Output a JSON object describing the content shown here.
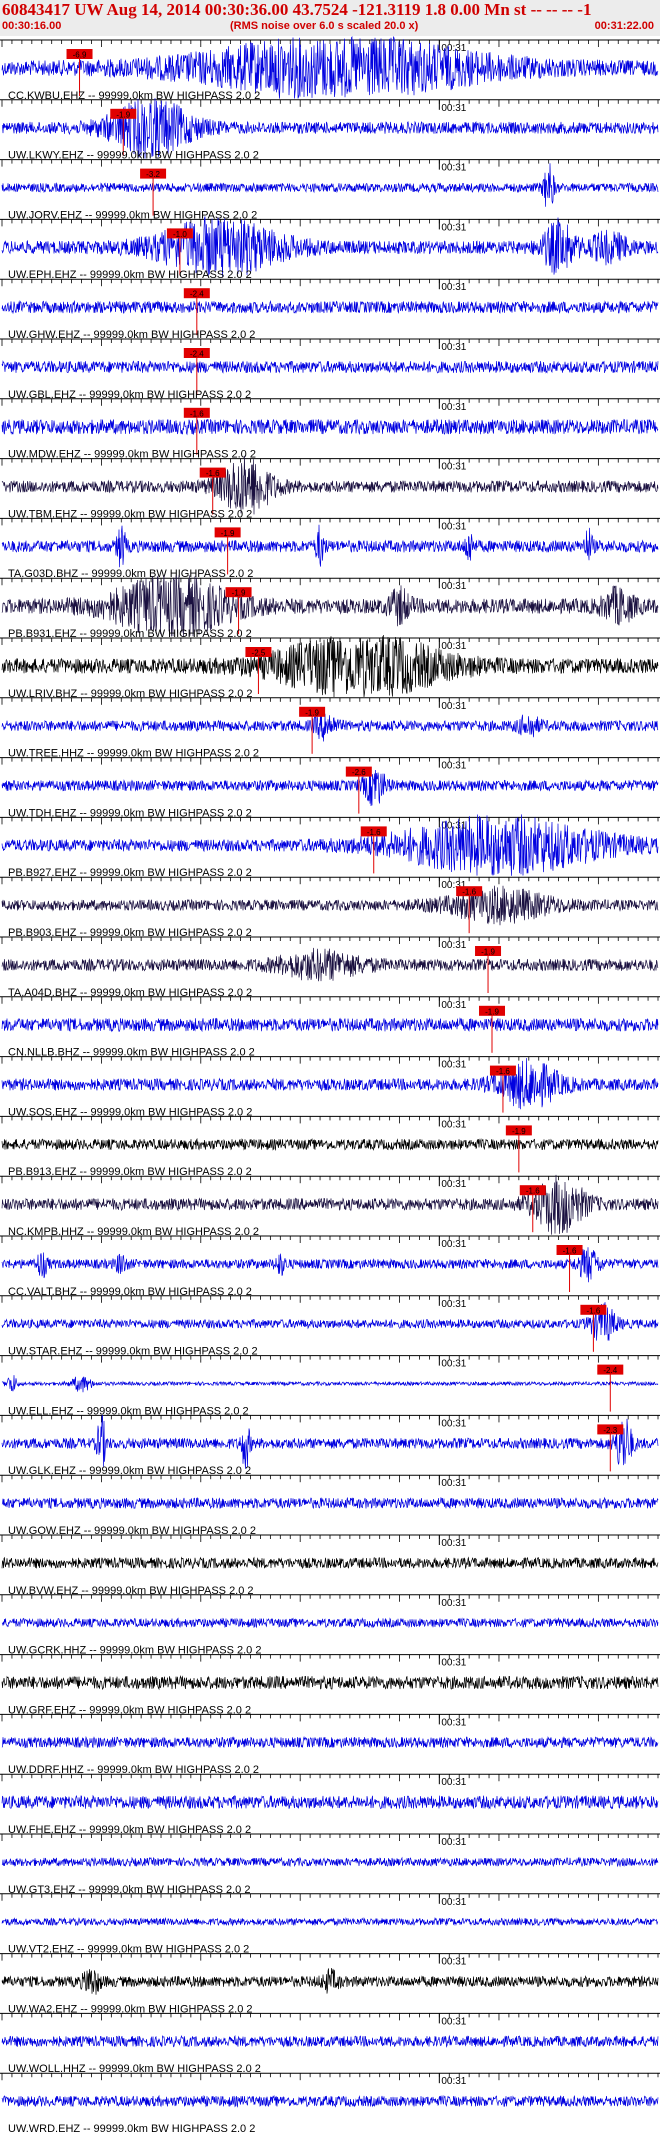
{
  "header": {
    "title": "60843417 UW Aug 14, 2014 00:30:36.00   43.7524 -121.3119  1.8 0.00 Mn st -- -- --  -1",
    "start_time": "00:30:16.00",
    "subtitle": "(RMS noise over 6.0 s scaled 20.0 x)",
    "end_time": "00:31:22.00"
  },
  "colors": {
    "header_text": "#d00000",
    "pick_marker": "#e00000",
    "trace_blue": "#0000e0",
    "trace_dark": "#1a1040",
    "trace_black": "#000000"
  },
  "chart_data": {
    "type": "line",
    "title": "60843417 UW Aug 14, 2014 00:30:36.00   43.7524 -121.3119  1.8 0.00 Mn st -- -- --  -1",
    "time_axis": {
      "start": "00:30:16.00",
      "end": "00:31:22.00",
      "minute_label": "00:31",
      "minute_mark_seconds": 44,
      "span_seconds": 66
    },
    "series": [
      {
        "label": "CC.KWBU.EHZ -- 99999.0km BW  HIGHPASS  2.0  2",
        "color": "blue",
        "pick": "-6.9",
        "pick_s": 7.8,
        "bursts": [
          {
            "t": 34,
            "w": 14,
            "a": 0.95
          }
        ],
        "noise": 0.25
      },
      {
        "label": "UW.LKWY.EHZ -- 99999.0km BW  HIGHPASS  2.0  2",
        "color": "blue",
        "pick": "-1.9",
        "pick_s": 12.2,
        "bursts": [
          {
            "t": 15,
            "w": 4,
            "a": 0.9
          }
        ],
        "noise": 0.2
      },
      {
        "label": "UW.JORV.EHZ -- 99999.0km BW  HIGHPASS  2.0  2",
        "color": "blue",
        "pick": "-3.2",
        "pick_s": 15.2,
        "bursts": [
          {
            "t": 55,
            "w": 0.5,
            "a": 0.8
          }
        ],
        "noise": 0.15
      },
      {
        "label": "UW.EPH.EHZ -- 99999.0km BW  HIGHPASS  2.0  2",
        "color": "blue",
        "pick": "-1.0",
        "pick_s": 17.9,
        "bursts": [
          {
            "t": 22,
            "w": 6,
            "a": 0.9
          },
          {
            "t": 56,
            "w": 1.5,
            "a": 0.8
          },
          {
            "t": 61,
            "w": 2,
            "a": 0.4
          }
        ],
        "noise": 0.22
      },
      {
        "label": "UW.GHW.EHZ -- 99999.0km BW  HIGHPASS  2.0  2",
        "color": "blue",
        "pick": "-2.4",
        "pick_s": 19.6,
        "bursts": [],
        "noise": 0.2
      },
      {
        "label": "UW.GBL.EHZ -- 99999.0km BW  HIGHPASS  2.0  2",
        "color": "blue",
        "pick": "-2.4",
        "pick_s": 19.6,
        "bursts": [],
        "noise": 0.2
      },
      {
        "label": "UW.MDW.EHZ -- 99999.0km BW  HIGHPASS  2.0  2",
        "color": "blue",
        "pick": "-1.6",
        "pick_s": 19.6,
        "bursts": [],
        "noise": 0.25
      },
      {
        "label": "UW.TBM.EHZ -- 99999.0km BW  HIGHPASS  2.0  2",
        "color": "dark",
        "pick": "-1.6",
        "pick_s": 21.2,
        "bursts": [
          {
            "t": 24.5,
            "w": 2.5,
            "a": 0.95
          }
        ],
        "noise": 0.2
      },
      {
        "label": "TA.G03D.BHZ -- 99999.0km BW  HIGHPASS  2.0  2",
        "color": "blue",
        "pick": "-1.9",
        "pick_s": 22.7,
        "bursts": [
          {
            "t": 12,
            "w": 0.4,
            "a": 0.7
          },
          {
            "t": 32,
            "w": 0.4,
            "a": 0.6
          },
          {
            "t": 47,
            "w": 0.4,
            "a": 0.5
          },
          {
            "t": 59,
            "w": 0.4,
            "a": 0.5
          }
        ],
        "noise": 0.2
      },
      {
        "label": "PB.B931.EHZ -- 99999.0km BW  HIGHPASS  2.0  2",
        "color": "dark",
        "pick": "-1.9",
        "pick_s": 23.8,
        "bursts": [
          {
            "t": 17,
            "w": 6,
            "a": 0.9
          },
          {
            "t": 40,
            "w": 1,
            "a": 0.5
          },
          {
            "t": 62,
            "w": 1.5,
            "a": 0.5
          }
        ],
        "noise": 0.25
      },
      {
        "label": "UW.LRIV.BHZ -- 99999.0km BW  HIGHPASS  2.0  2",
        "color": "black",
        "pick": "-2.5",
        "pick_s": 25.8,
        "bursts": [
          {
            "t": 36,
            "w": 8,
            "a": 1.0
          }
        ],
        "noise": 0.25
      },
      {
        "label": "UW.TREE.HHZ -- 99999.0km BW  HIGHPASS  2.0  2",
        "color": "blue",
        "pick": "-1.9",
        "pick_s": 31.2,
        "bursts": [
          {
            "t": 32.5,
            "w": 1,
            "a": 0.4
          },
          {
            "t": 53,
            "w": 1,
            "a": 0.3
          }
        ],
        "noise": 0.18
      },
      {
        "label": "UW.TDH.EHZ -- 99999.0km BW  HIGHPASS  2.0  2",
        "color": "blue",
        "pick": "-2.6",
        "pick_s": 35.9,
        "bursts": [
          {
            "t": 37.5,
            "w": 1,
            "a": 0.6
          }
        ],
        "noise": 0.18
      },
      {
        "label": "PB.B927.EHZ -- 99999.0km BW  HIGHPASS  2.0  2",
        "color": "blue",
        "pick": "-1.6",
        "pick_s": 37.4,
        "bursts": [
          {
            "t": 50,
            "w": 10,
            "a": 0.9
          }
        ],
        "noise": 0.2
      },
      {
        "label": "PB.B903.EHZ -- 99999.0km BW  HIGHPASS  2.0  2",
        "color": "dark",
        "pick": "-1.6",
        "pick_s": 47.0,
        "bursts": [
          {
            "t": 50,
            "w": 5,
            "a": 0.5
          }
        ],
        "noise": 0.18
      },
      {
        "label": "TA.A04D.BHZ -- 99999.0km BW  HIGHPASS  2.0  2",
        "color": "dark",
        "pick": "-1.9",
        "pick_s": 48.9,
        "bursts": [
          {
            "t": 32,
            "w": 4,
            "a": 0.4
          }
        ],
        "noise": 0.2
      },
      {
        "label": "CN.NLLB.BHZ -- 99999.0km BW  HIGHPASS  2.0  2",
        "color": "blue",
        "pick": "-1.9",
        "pick_s": 49.3,
        "bursts": [],
        "noise": 0.22
      },
      {
        "label": "UW.SOS.EHZ -- 99999.0km BW  HIGHPASS  2.0  2",
        "color": "blue",
        "pick": "-1.6",
        "pick_s": 50.4,
        "bursts": [
          {
            "t": 53,
            "w": 3,
            "a": 0.7
          }
        ],
        "noise": 0.2
      },
      {
        "label": "PB.B913.EHZ -- 99999.0km BW  HIGHPASS  2.0  2",
        "color": "black",
        "pick": "-1.9",
        "pick_s": 52.0,
        "bursts": [],
        "noise": 0.18
      },
      {
        "label": "NC.KMPB.HHZ -- 99999.0km BW  HIGHPASS  2.0  2",
        "color": "dark",
        "pick": "-1.6",
        "pick_s": 53.4,
        "bursts": [
          {
            "t": 56,
            "w": 2.5,
            "a": 0.9
          }
        ],
        "noise": 0.2
      },
      {
        "label": "CC.VALT.BHZ -- 99999.0km BW  HIGHPASS  2.0  2",
        "color": "blue",
        "pick": "-1.6",
        "pick_s": 57.1,
        "bursts": [
          {
            "t": 4,
            "w": 0.5,
            "a": 0.4
          },
          {
            "t": 12,
            "w": 0.5,
            "a": 0.3
          },
          {
            "t": 28,
            "w": 0.5,
            "a": 0.3
          },
          {
            "t": 59,
            "w": 1,
            "a": 0.5
          }
        ],
        "noise": 0.16
      },
      {
        "label": "UW.STAR.EHZ -- 99999.0km BW  HIGHPASS  2.0  2",
        "color": "blue",
        "pick": "-1.6",
        "pick_s": 59.5,
        "bursts": [
          {
            "t": 60.5,
            "w": 1.2,
            "a": 0.6
          }
        ],
        "noise": 0.15
      },
      {
        "label": "UW.ELL.EHZ -- 99999.0km BW  HIGHPASS  2.0  2",
        "color": "blue",
        "pick": "-2.4",
        "pick_s": 61.2,
        "bursts": [
          {
            "t": 1,
            "w": 0.5,
            "a": 0.3
          },
          {
            "t": 8,
            "w": 1,
            "a": 0.25
          }
        ],
        "noise": 0.06
      },
      {
        "label": "UW.GLK.EHZ -- 99999.0km BW  HIGHPASS  2.0  2",
        "color": "blue",
        "pick": "-2.3",
        "pick_s": 61.2,
        "bursts": [
          {
            "t": 10,
            "w": 0.4,
            "a": 0.9
          },
          {
            "t": 24.5,
            "w": 0.4,
            "a": 0.8
          },
          {
            "t": 62.5,
            "w": 0.8,
            "a": 0.95
          }
        ],
        "noise": 0.18
      },
      {
        "label": "UW.GOW.EHZ -- 99999.0km BW  HIGHPASS  2.0  2",
        "color": "blue",
        "pick": "",
        "pick_s": null,
        "bursts": [],
        "noise": 0.18
      },
      {
        "label": "UW.BVW.EHZ -- 99999.0km BW  HIGHPASS  2.0  2",
        "color": "black",
        "pick": "",
        "pick_s": null,
        "bursts": [],
        "noise": 0.18
      },
      {
        "label": "UW.GCRK.HHZ -- 99999.0km BW  HIGHPASS  2.0  2",
        "color": "blue",
        "pick": "",
        "pick_s": null,
        "bursts": [],
        "noise": 0.15
      },
      {
        "label": "UW.GRF.EHZ -- 99999.0km BW  HIGHPASS  2.0  2",
        "color": "black",
        "pick": "",
        "pick_s": null,
        "bursts": [],
        "noise": 0.22
      },
      {
        "label": "UW.DDRF.HHZ -- 99999.0km BW  HIGHPASS  2.0  2",
        "color": "blue",
        "pick": "",
        "pick_s": null,
        "bursts": [],
        "noise": 0.18
      },
      {
        "label": "UW.FHE.EHZ -- 99999.0km BW  HIGHPASS  2.0  2",
        "color": "blue",
        "pick": "",
        "pick_s": null,
        "bursts": [],
        "noise": 0.22
      },
      {
        "label": "UW.GT3.EHZ -- 99999.0km BW  HIGHPASS  2.0  2",
        "color": "blue",
        "pick": "",
        "pick_s": null,
        "bursts": [],
        "noise": 0.14
      },
      {
        "label": "UW.VT2.EHZ -- 99999.0km BW  HIGHPASS  2.0  2",
        "color": "blue",
        "pick": "",
        "pick_s": null,
        "bursts": [],
        "noise": 0.12
      },
      {
        "label": "UW.WA2.EHZ -- 99999.0km BW  HIGHPASS  2.0  2",
        "color": "black",
        "pick": "",
        "pick_s": null,
        "bursts": [
          {
            "t": 9,
            "w": 0.8,
            "a": 0.4
          },
          {
            "t": 33,
            "w": 0.8,
            "a": 0.3
          }
        ],
        "noise": 0.18
      },
      {
        "label": "UW.WOLL.HHZ -- 99999.0km BW  HIGHPASS  2.0  2",
        "color": "blue",
        "pick": "",
        "pick_s": null,
        "bursts": [],
        "noise": 0.18
      },
      {
        "label": "UW.WRD.EHZ -- 99999.0km BW  HIGHPASS  2.0  2",
        "color": "blue",
        "pick": "",
        "pick_s": null,
        "bursts": [],
        "noise": 0.18
      }
    ]
  }
}
